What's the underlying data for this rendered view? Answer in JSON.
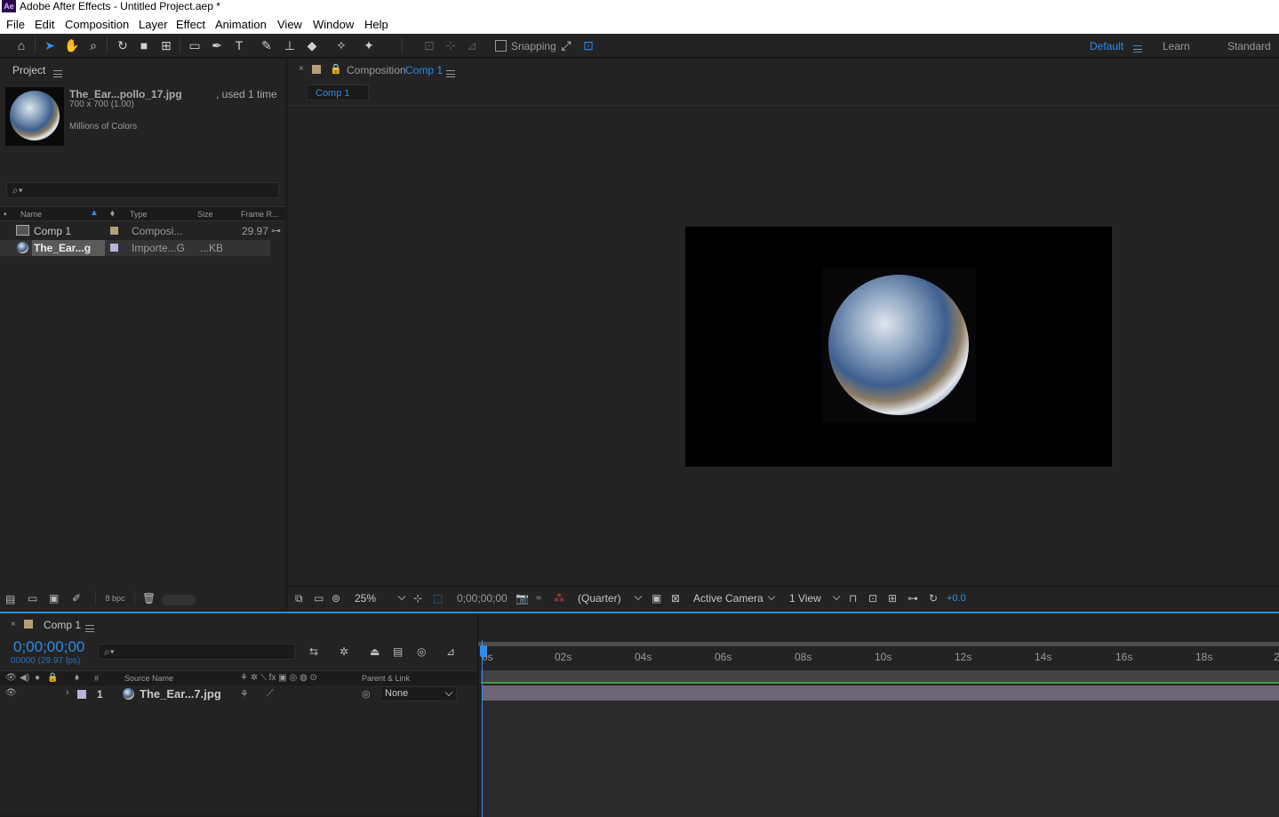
{
  "window": {
    "app_icon": "Ae",
    "title": "Adobe After Effects - Untitled Project.aep *"
  },
  "menu": [
    "File",
    "Edit",
    "Composition",
    "Layer",
    "Effect",
    "Animation",
    "View",
    "Window",
    "Help"
  ],
  "toolbar": {
    "snapping_label": "Snapping",
    "workspaces": {
      "default": "Default",
      "learn": "Learn",
      "standard": "Standard"
    }
  },
  "project": {
    "tab": "Project",
    "preview": {
      "name": "The_Ear...pollo_17.jpg",
      "usage": ", used 1 time",
      "dimensions": "700 x 700 (1.00)",
      "colors": "Millions of Colors"
    },
    "columns": {
      "name": "Name",
      "type": "Type",
      "size": "Size",
      "frame_rate": "Frame R..."
    },
    "rows": [
      {
        "name": "Comp 1",
        "type": "Composi...",
        "size": "",
        "frame_rate": "29.97",
        "label_color": "#b5a07a"
      },
      {
        "name": "The_Ear...g",
        "type": "Importe...G",
        "size": "...KB",
        "frame_rate": "",
        "label_color": "#b9b2dc"
      }
    ],
    "bpc": "8 bpc"
  },
  "composition": {
    "tab_prefix": "Composition",
    "tab_name": "Comp 1",
    "subtab": "Comp 1",
    "footer": {
      "zoom": "25%",
      "timecode": "0;00;00;00",
      "resolution": "(Quarter)",
      "camera": "Active Camera",
      "views": "1 View",
      "exposure": "+0.0"
    }
  },
  "timeline": {
    "tab": "Comp 1",
    "timecode": "0;00;00;00",
    "frame_info": "00000 (29.97 fps)",
    "columns": {
      "num": "#",
      "source_name": "Source Name",
      "parent": "Parent & Link"
    },
    "layer": {
      "index": "1",
      "name": "The_Ear...7.jpg",
      "parent": "None"
    },
    "ruler": [
      "0s",
      "02s",
      "04s",
      "06s",
      "08s",
      "10s",
      "12s",
      "14s",
      "16s",
      "18s",
      "2"
    ]
  },
  "colors": {
    "accent": "#2d8ceb",
    "panel_bg": "#232323",
    "timeline_green": "#3fa23f",
    "layer_bar": "#6d6676"
  }
}
